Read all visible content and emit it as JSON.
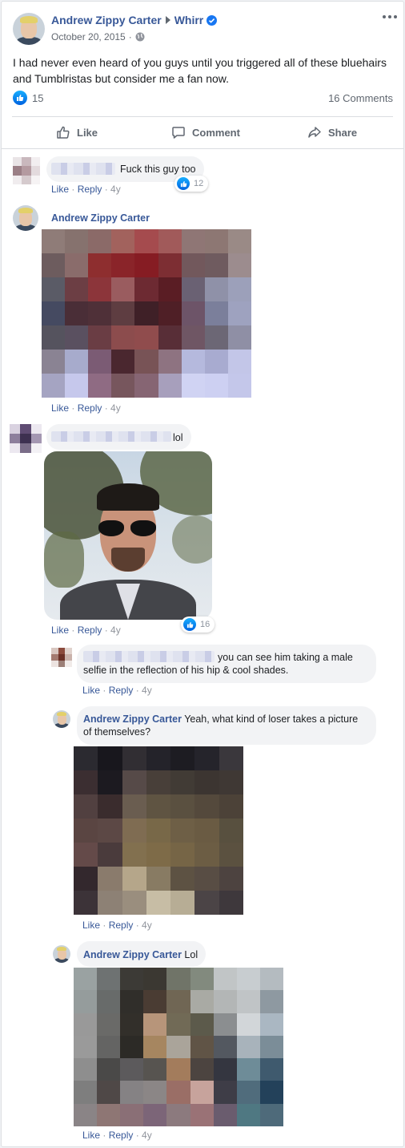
{
  "post": {
    "author": "Andrew Zippy Carter",
    "target": "Whirr",
    "date": "October 20, 2015",
    "body": "I had never even heard of you guys until you triggered all of these bluehairs and Tumblristas but consider me a fan now.",
    "likes": "15",
    "comments_count": "16 Comments"
  },
  "actions": {
    "like": "Like",
    "comment": "Comment",
    "share": "Share"
  },
  "comments": [
    {
      "author": "",
      "text": "Fuck this guy too",
      "like": "Like",
      "reply": "Reply",
      "age": "4y",
      "reactions": "12"
    },
    {
      "author": "Andrew Zippy Carter",
      "text": "",
      "like": "Like",
      "reply": "Reply",
      "age": "4y"
    },
    {
      "author": "",
      "text": "lol",
      "like": "Like",
      "reply": "Reply",
      "age": "4y",
      "reactions": "16"
    },
    {
      "author": "",
      "text": "you can see him taking a male selfie in the reflection of his hip & cool shades.",
      "like": "Like",
      "reply": "Reply",
      "age": "4y"
    },
    {
      "author": "Andrew Zippy Carter",
      "text": "Yeah, what kind of loser takes a picture of themselves?",
      "like": "Like",
      "reply": "Reply",
      "age": "4y"
    },
    {
      "author": "Andrew Zippy Carter",
      "text": "Lol",
      "like": "Like",
      "reply": "Reply",
      "age": "4y"
    }
  ],
  "icons": {
    "more": "more-options-icon",
    "globe": "globe-icon",
    "verified": "verified-badge-icon",
    "arrow": "arrow-right-icon",
    "like": "thumbs-up-icon",
    "comment": "speech-bubble-icon",
    "share": "share-arrow-icon"
  },
  "colors": {
    "link": "#385898",
    "like_blue": "#1877f2",
    "bubble": "#f2f3f5"
  }
}
